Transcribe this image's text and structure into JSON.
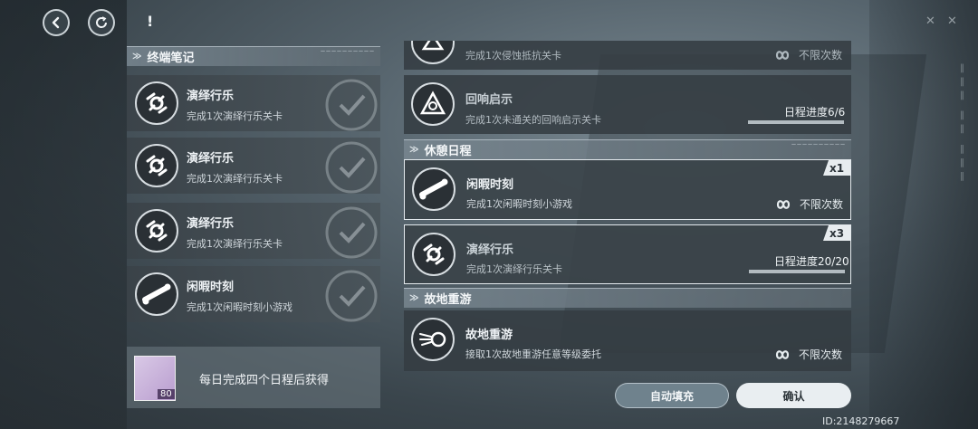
{
  "top": {
    "excl": "!"
  },
  "left": {
    "section_title": "终端笔记",
    "section_code": "——————————",
    "cards": [
      {
        "title": "演绎行乐",
        "desc": "完成1次演绎行乐关卡",
        "icon": "performance-icon"
      },
      {
        "title": "演绎行乐",
        "desc": "完成1次演绎行乐关卡",
        "icon": "performance-icon"
      },
      {
        "title": "演绎行乐",
        "desc": "完成1次演绎行乐关卡",
        "icon": "performance-icon"
      },
      {
        "title": "闲暇时刻",
        "desc": "完成1次闲暇时刻小游戏",
        "icon": "bone-icon"
      }
    ],
    "reward": {
      "text": "每日完成四个日程后获得",
      "count": "80"
    }
  },
  "right": {
    "partial_card": {
      "desc": "完成1次侵蚀抵抗关卡",
      "unlimited": "不限次数"
    },
    "echo_card": {
      "title": "回响启示",
      "desc": "完成1次未通关的回响启示关卡",
      "progress_label": "日程进度6/6",
      "progress": 1.0
    },
    "rest_section": "休憩日程",
    "leisure_card": {
      "title": "闲暇时刻",
      "desc": "完成1次闲暇时刻小游戏",
      "badge": "x1",
      "unlimited": "不限次数"
    },
    "perform_card": {
      "title": "演绎行乐",
      "desc": "完成1次演绎行乐关卡",
      "badge": "x3",
      "progress_label": "日程进度20/20",
      "progress": 1.0
    },
    "revisit_section": "故地重游",
    "revisit_card": {
      "title": "故地重游",
      "desc": "接取1次故地重游任意等级委托",
      "unlimited": "不限次数"
    }
  },
  "buttons": {
    "auto_fill": "自动填充",
    "confirm": "确认"
  },
  "uid": "ID:2148279667"
}
